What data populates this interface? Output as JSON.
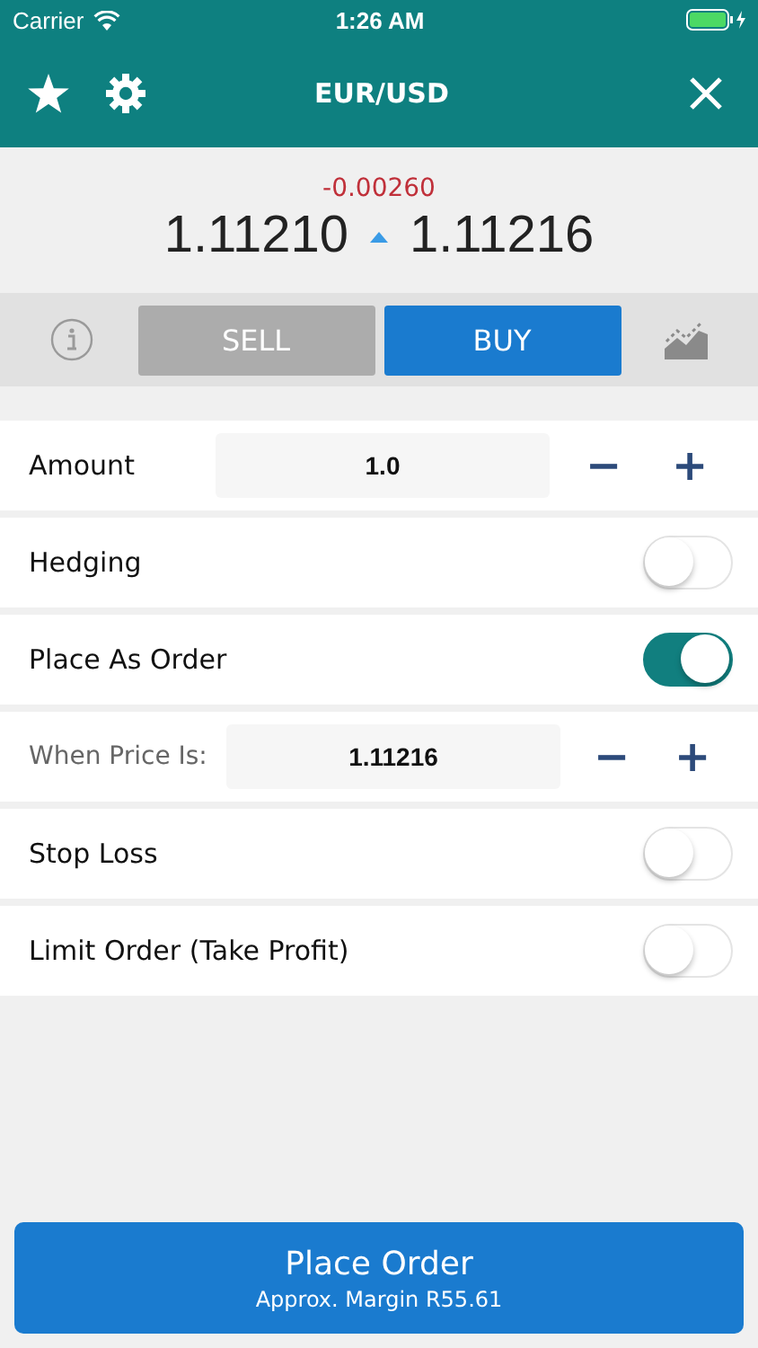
{
  "status_bar": {
    "carrier": "Carrier",
    "time": "1:26 AM"
  },
  "header": {
    "title": "EUR/USD"
  },
  "quote": {
    "change": "-0.00260",
    "sell_price": "1.11210",
    "buy_price": "1.11216"
  },
  "sides": [
    {
      "label": "SELL",
      "selected": false
    },
    {
      "label": "BUY",
      "selected": true
    }
  ],
  "rows": [
    {
      "kind": "stepper",
      "label": "Amount",
      "value": "1.0",
      "minus": "−",
      "plus": "+"
    },
    {
      "kind": "toggle",
      "label": "Hedging",
      "on": false
    },
    {
      "kind": "toggle",
      "label": "Place As Order",
      "on": true
    },
    {
      "kind": "sub-stepper",
      "label": "When Price Is:",
      "value": "1.11216",
      "minus": "−",
      "plus": "+"
    },
    {
      "kind": "toggle",
      "label": "Stop Loss",
      "on": false
    },
    {
      "kind": "toggle",
      "label": "Limit Order (Take Profit)",
      "on": false
    }
  ],
  "place_order": {
    "label": "Place Order",
    "margin": "Approx. Margin R55.61"
  }
}
